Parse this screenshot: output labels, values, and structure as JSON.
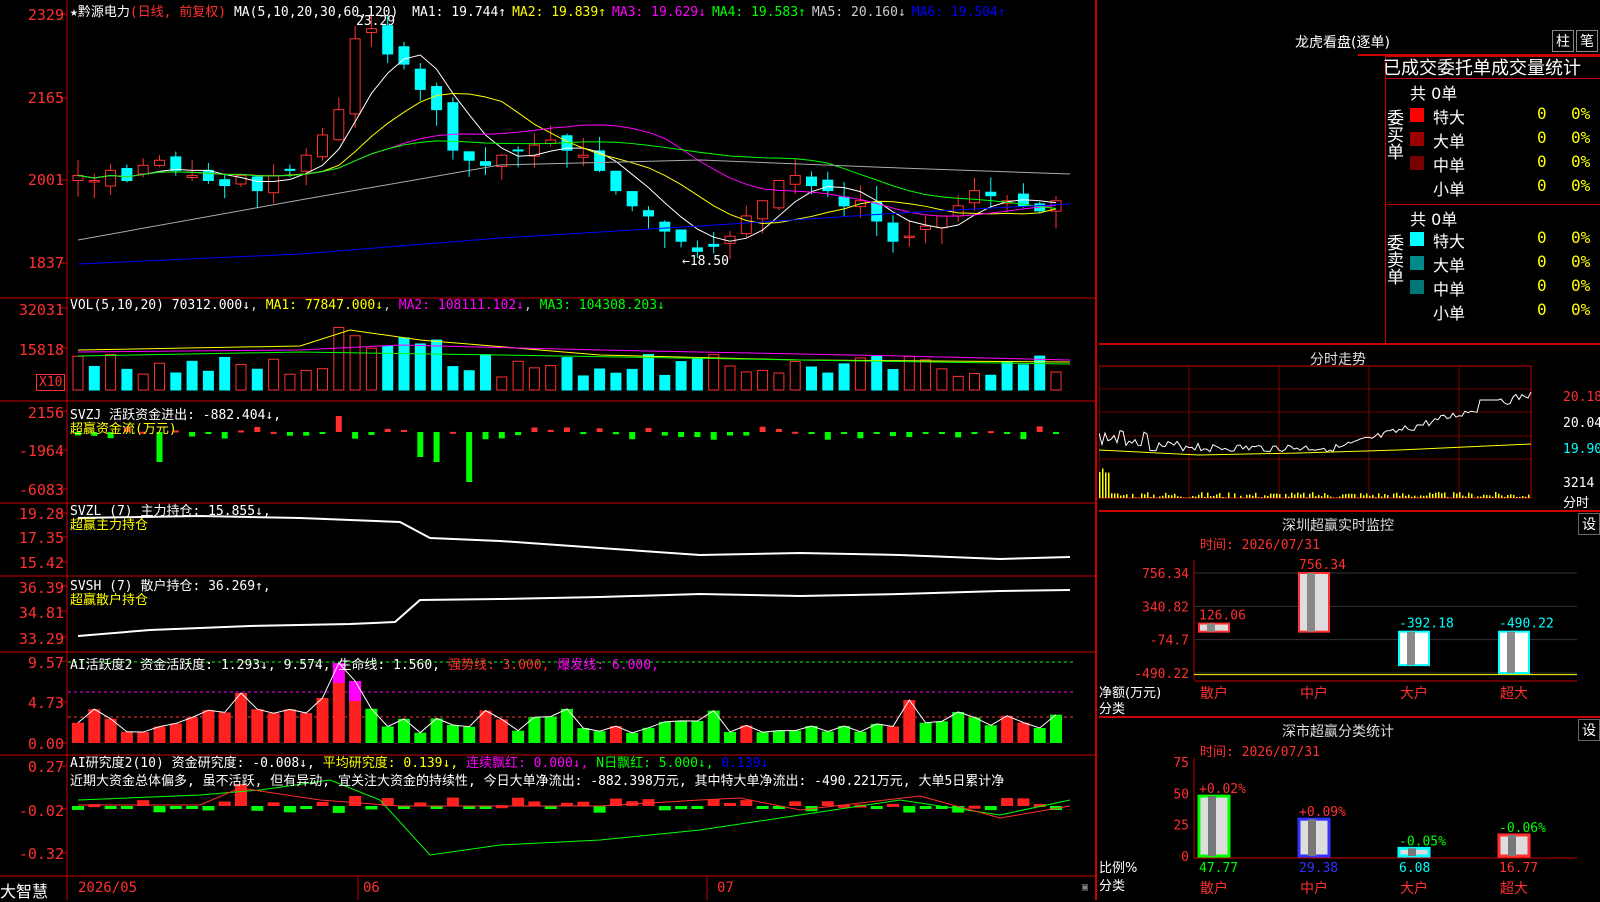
{
  "app_name": "大智慧",
  "main": {
    "stock": "★黔源电力",
    "period": "(日线, 前复权)",
    "ma_label": "MA(5,10,20,30,60,120)",
    "ma_items": [
      {
        "label": "MA1: 19.744↑",
        "color": "#ffffff"
      },
      {
        "label": "MA2: 19.839↑",
        "color": "#ffff00"
      },
      {
        "label": "MA3: 19.629↓",
        "color": "#ff00ff"
      },
      {
        "label": "MA4: 19.583↑",
        "color": "#00ff00"
      },
      {
        "label": "MA5: 20.160↓",
        "color": "#cccccc"
      },
      {
        "label": "MA6: 19.504↑",
        "color": "#0000ff"
      }
    ],
    "ticks": [
      "2329",
      "2165",
      "2001",
      "1837"
    ],
    "high_label": "23.29",
    "low_label": "←18.50"
  },
  "vol": {
    "header": "VOL(5,10,20)",
    "value": "70312.000↓",
    "ma1": "MA1: 77847.000↓",
    "ma2": "MA2: 108111.102↓",
    "ma3": "MA3: 104308.203↓",
    "ticks": [
      "32031",
      "15818"
    ],
    "unit": "X10"
  },
  "svzj": {
    "header": "SVZJ  活跃资金进出: -882.404↓,",
    "sub": "超赢资金流(万元)",
    "ticks": [
      "2156",
      "-1964",
      "-6083"
    ]
  },
  "svzl": {
    "header": "SVZL (7) 主力持仓: 15.855↓,",
    "sub": "超赢主力持仓",
    "ticks": [
      "19.28",
      "17.35",
      "15.42"
    ]
  },
  "svsh": {
    "header": "SVSH (7) 散户持仓: 36.269↑,",
    "sub": "超赢散户持仓",
    "ticks": [
      "36.39",
      "34.81",
      "33.29"
    ]
  },
  "ai1": {
    "header": "AI活跃度2 资金活跃度: 1.293↓, 9.574, 生命线: 1.560,",
    "strong": "强势线: 3.000,",
    "burst": "爆发线: 6.000,",
    "ticks": [
      "9.57",
      "4.73",
      "0.00"
    ]
  },
  "ai2": {
    "header": "AI研究度2(10) 资金研究度: -0.008↓,",
    "avg": "平均研究度: 0.139↓,",
    "cont": "连续飘红: 0.000↓,",
    "nday": "N日飘红: 5.000↓,",
    "last": "0.139↓",
    "comment": "近期大资金总体偏多, 虽不活跃, 但有异动, 宜关注大资金的持续性, 今日大单净流出: -882.398万元, 其中特大单净流出: -490.221万元, 大单5日累计净",
    "ticks": [
      "0.27",
      "-0.02",
      "-0.32"
    ]
  },
  "dates": [
    "2026/05",
    "06",
    "07"
  ],
  "lhb": {
    "title": "龙虎看盘(逐单)",
    "btn1": "柱",
    "btn2": "笔",
    "subtitle": "已成交委托单成交量统计",
    "buy_side": "委买单",
    "sell_side": "委卖单",
    "buy_total": "共 0单",
    "sell_total": "共 0单",
    "buy_rows": [
      {
        "name": "特大",
        "val": "0",
        "pct": "0%",
        "color": "#ff0000"
      },
      {
        "name": "大单",
        "val": "0",
        "pct": "0%",
        "color": "#990000"
      },
      {
        "name": "中单",
        "val": "0",
        "pct": "0%",
        "color": "#770000"
      },
      {
        "name": "小单",
        "val": "0",
        "pct": "0%",
        "color": ""
      }
    ],
    "sell_rows": [
      {
        "name": "特大",
        "val": "0",
        "pct": "0%",
        "color": "#00ffff"
      },
      {
        "name": "大单",
        "val": "0",
        "pct": "0%",
        "color": "#008b8b"
      },
      {
        "name": "中单",
        "val": "0",
        "pct": "0%",
        "color": "#007777"
      },
      {
        "name": "小单",
        "val": "0",
        "pct": "0%",
        "color": ""
      }
    ]
  },
  "fenshi": {
    "title": "分时走势",
    "ticks": [
      "20.18",
      "20.04",
      "19.90"
    ],
    "vol_tick": "3214",
    "vol_label": "分时"
  },
  "monitor": {
    "title": "深圳超赢实时监控",
    "settings": "设",
    "time": "时间: 2026/07/31",
    "ticks": [
      "756.34",
      "340.82",
      "-74.7",
      "-490.22"
    ],
    "ylabel": "净额(万元)",
    "xlabel": "分类",
    "bars": [
      {
        "label": "散户",
        "value": "126.06"
      },
      {
        "label": "中户",
        "value": "756.34"
      },
      {
        "label": "大户",
        "value": "-392.18"
      },
      {
        "label": "超大",
        "value": "-490.22"
      }
    ]
  },
  "classify": {
    "title": "深市超赢分类统计",
    "settings": "设",
    "time": "时间: 2026/07/31",
    "ticks": [
      "75",
      "50",
      "25",
      "0"
    ],
    "ylabel": "比例%",
    "xlabel": "分类",
    "bars": [
      {
        "label": "散户",
        "value": "47.77",
        "chg": "+0.02%"
      },
      {
        "label": "中户",
        "value": "29.38",
        "chg": "+0.09%"
      },
      {
        "label": "大户",
        "value": "6.08",
        "chg": "-0.05%"
      },
      {
        "label": "超大",
        "value": "16.77",
        "chg": "-0.06%"
      }
    ]
  },
  "chart_data": [
    {
      "type": "candlestick",
      "ylim": [
        18.37,
        23.29
      ],
      "x": [
        "2026/05",
        "06",
        "07"
      ],
      "annotations": [
        "23.29",
        "←18.50"
      ]
    },
    {
      "type": "bar",
      "ylim": [
        0,
        3203.1
      ]
    },
    {
      "type": "bar",
      "name": "超赢资金流(万元)",
      "ylim": [
        -6083,
        2156
      ]
    },
    {
      "type": "bar",
      "categories": [
        "散户",
        "中户",
        "大户",
        "超大"
      ],
      "values": [
        126.06,
        756.34,
        -392.18,
        -490.22
      ],
      "ylabel": "净额(万元)",
      "xlabel": "分类",
      "ylim": [
        -490.22,
        756.34
      ]
    },
    {
      "type": "bar",
      "categories": [
        "散户",
        "中户",
        "大户",
        "超大"
      ],
      "values": [
        47.77,
        29.38,
        6.08,
        16.77
      ],
      "changes": [
        "+0.02%",
        "+0.09%",
        "-0.05%",
        "-0.06%"
      ],
      "ylabel": "比例%",
      "xlabel": "分类",
      "ylim": [
        0,
        75
      ]
    }
  ]
}
